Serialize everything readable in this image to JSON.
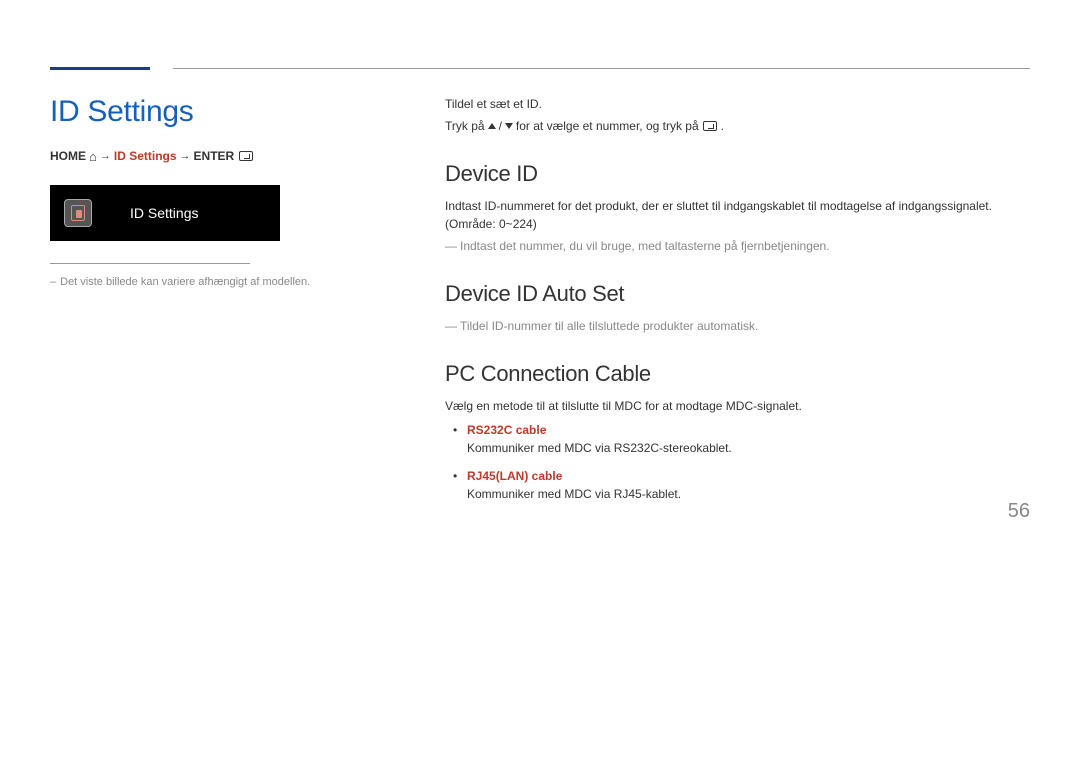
{
  "page_number": "56",
  "left": {
    "title": "ID Settings",
    "breadcrumb": {
      "home": "HOME",
      "item": "ID Settings",
      "enter": "ENTER"
    },
    "preview_label": "ID Settings",
    "note": "Det viste billede kan variere afhængigt af modellen."
  },
  "right": {
    "intro1": "Tildel et sæt et ID.",
    "intro2a": "Tryk på ",
    "intro2b": " for at vælge et nummer, og tryk på ",
    "intro2c": ".",
    "device_id": {
      "heading": "Device ID",
      "body": "Indtast ID-nummeret for det produkt, der er sluttet til indgangskablet til modtagelse af indgangssignalet. (Område: 0~224)",
      "footnote": "Indtast det nummer, du vil bruge, med taltasterne på fjernbetjeningen."
    },
    "auto_set": {
      "heading": "Device ID Auto Set",
      "footnote": "Tildel ID-nummer til alle tilsluttede produkter automatisk."
    },
    "pc_cable": {
      "heading": "PC Connection Cable",
      "body": "Vælg en metode til at tilslutte til MDC for at modtage MDC-signalet.",
      "cables": [
        {
          "name": "RS232C cable",
          "desc": "Kommuniker med MDC via RS232C-stereokablet."
        },
        {
          "name": "RJ45(LAN) cable",
          "desc": "Kommuniker med MDC via RJ45-kablet."
        }
      ]
    }
  }
}
